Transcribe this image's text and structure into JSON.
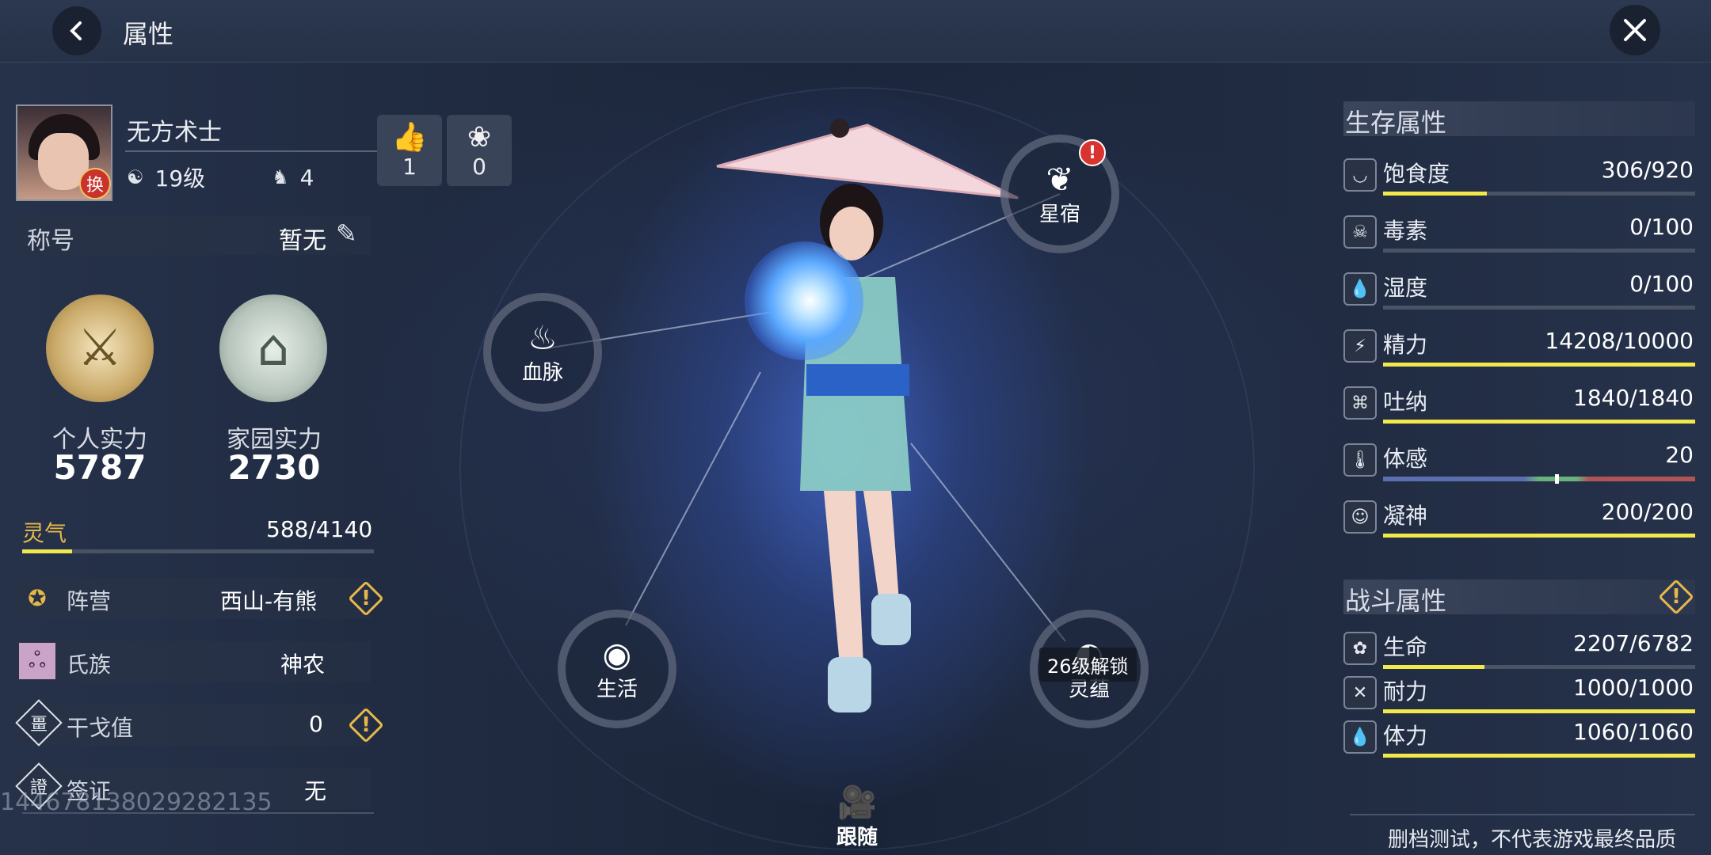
{
  "header": {
    "title": "属性"
  },
  "player": {
    "name": "无方术士",
    "level": "19级",
    "follow_count": "4",
    "likes": "1",
    "flowers": "0",
    "swap_label": "换"
  },
  "title_row": {
    "label": "称号",
    "value": "暂无"
  },
  "power": {
    "personal_label": "个人实力",
    "personal_value": "5787",
    "home_label": "家园实力",
    "home_value": "2730"
  },
  "lingqi": {
    "label": "灵气",
    "value": "588/4140",
    "fraction": 0.142
  },
  "info_rows": [
    {
      "label": "阵营",
      "value": "西山-有熊",
      "warn": true
    },
    {
      "label": "氏族",
      "value": "神农",
      "warn": false
    },
    {
      "label": "干戈值",
      "value": "0",
      "warn": true
    },
    {
      "label": "签证",
      "value": "无",
      "warn": false
    }
  ],
  "debug_id": "14467813802928213​5",
  "nodes": {
    "xingxiu": "星宿",
    "xuemai": "血脉",
    "shenghuo": "生活",
    "lingyun": "灵蕴",
    "lingyun_lock": "26级解锁"
  },
  "follow_label": "跟随",
  "survival": {
    "title": "生存属性",
    "rows": [
      {
        "label": "饱食度",
        "value": "306/920",
        "fraction": 0.333,
        "icon": "stomach-icon"
      },
      {
        "label": "毒素",
        "value": "0/100",
        "fraction": 0,
        "icon": "poison-icon"
      },
      {
        "label": "湿度",
        "value": "0/100",
        "fraction": 0,
        "icon": "humidity-icon"
      },
      {
        "label": "精力",
        "value": "14208/10000",
        "fraction": 1,
        "icon": "energy-icon"
      },
      {
        "label": "吐纳",
        "value": "1840/1840",
        "fraction": 1,
        "icon": "lungs-icon"
      },
      {
        "label": "体感",
        "value": "20",
        "fraction": 0.55,
        "icon": "thermometer-icon"
      },
      {
        "label": "凝神",
        "value": "200/200",
        "fraction": 1,
        "icon": "focus-icon"
      }
    ]
  },
  "combat": {
    "title": "战斗属性",
    "rows": [
      {
        "label": "生命",
        "value": "2207/6782",
        "fraction": 0.325,
        "icon": "life-icon"
      },
      {
        "label": "耐力",
        "value": "1000/1000",
        "fraction": 1,
        "icon": "stamina-icon"
      },
      {
        "label": "体力",
        "value": "1060/1060",
        "fraction": 1,
        "icon": "vitality-icon"
      }
    ]
  },
  "disclaimer": "删档测试，不代表游戏最终品质",
  "colors": {
    "accent_bar": "#f3e84b",
    "warning": "#e6b84a",
    "alert": "#d9332f"
  }
}
